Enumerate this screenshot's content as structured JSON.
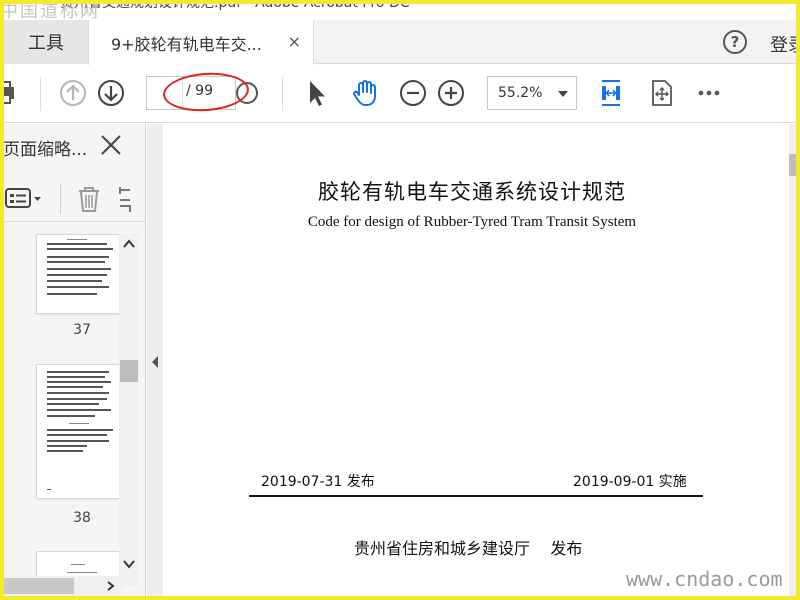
{
  "window": {
    "title": "贵州省交通规划设计规范.pdf - Adobe Acrobat Pro DC",
    "site_mark": "中国道标网"
  },
  "tabs": {
    "tools_label": "工具",
    "document_label": "9+胶轮有轨电车交...",
    "close_glyph": "×",
    "help_glyph": "?",
    "login_label": "登录"
  },
  "toolbar": {
    "page_current": "",
    "page_total": "/ 99",
    "zoom_value": "55.2%"
  },
  "left_panel": {
    "title": "页面缩略...",
    "thumbnails": [
      {
        "label": "37"
      },
      {
        "label": "38"
      }
    ]
  },
  "document": {
    "title": "胶轮有轨电车交通系统设计规范",
    "subtitle": "Code for design of Rubber-Tyred Tram Transit System",
    "issue_date": "2019-07-31 发布",
    "implementation_date": "2019-09-01 实施",
    "issuer": "贵州省住房和城乡建设厅    发布"
  },
  "watermark": "www.cndao.com",
  "colors": {
    "frame": "#f3ea2c",
    "annotation": "#e02020",
    "accent_blue": "#1473e6"
  }
}
